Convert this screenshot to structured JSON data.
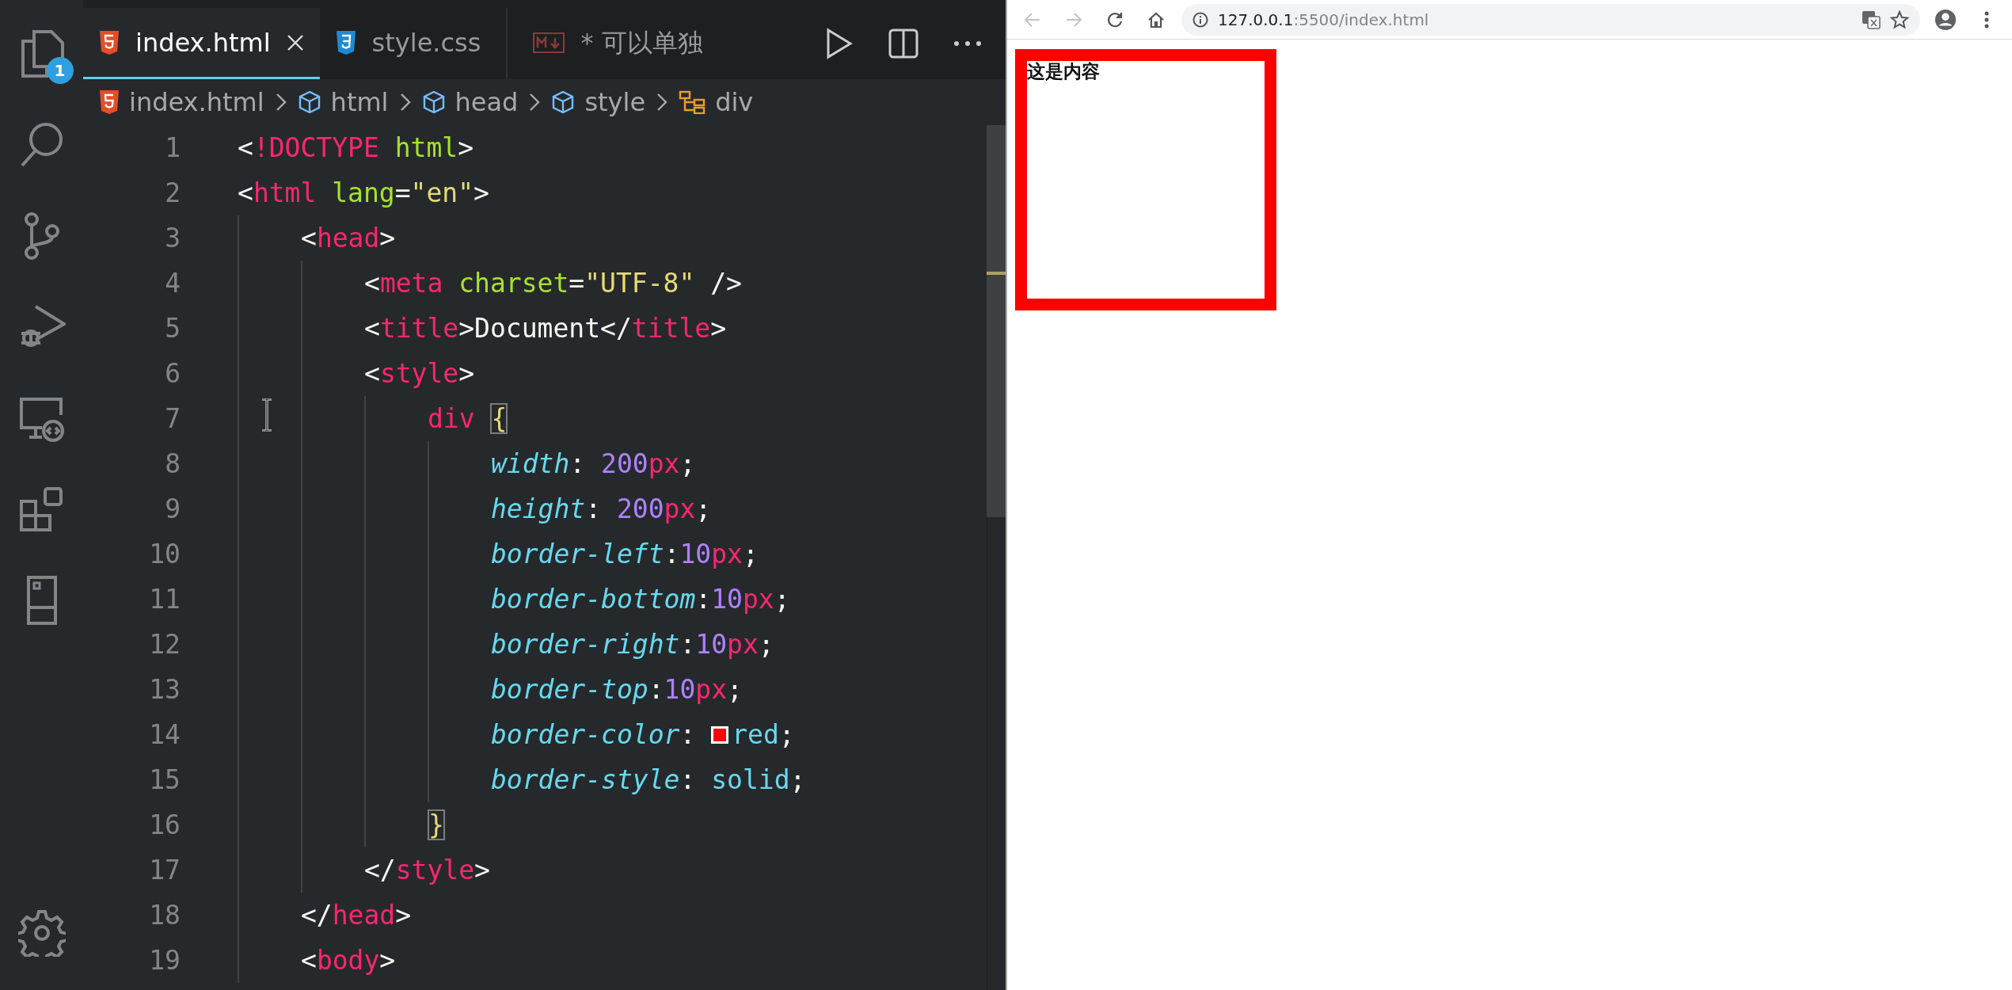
{
  "activity_bar": {
    "items": [
      {
        "kind": "files",
        "badge": "1"
      },
      {
        "kind": "search"
      },
      {
        "kind": "source-control"
      },
      {
        "kind": "run-debug"
      },
      {
        "kind": "remote"
      },
      {
        "kind": "extensions"
      },
      {
        "kind": "panel"
      }
    ],
    "bottom_items": [
      {
        "kind": "settings"
      }
    ]
  },
  "tabs": [
    {
      "label": "index.html",
      "kind": "html",
      "selected": true
    },
    {
      "label": "style.css",
      "kind": "css",
      "selected": false
    },
    {
      "label": "* 可以单独",
      "kind": "markdown",
      "selected": false
    }
  ],
  "breadcrumbs": [
    {
      "label": "index.html",
      "kind": "html"
    },
    {
      "label": "html",
      "kind": "element"
    },
    {
      "label": "head",
      "kind": "element"
    },
    {
      "label": "style",
      "kind": "element"
    },
    {
      "label": "div",
      "kind": "selector"
    }
  ],
  "code": {
    "lines": [
      {
        "number": "1",
        "tokens": [
          {
            "text": "<",
            "kind": "punct"
          },
          {
            "text": "!DOCTYPE",
            "kind": "tag"
          },
          {
            "text": " html",
            "kind": "attr"
          },
          {
            "text": ">",
            "kind": "punct"
          }
        ]
      },
      {
        "number": "2",
        "tokens": [
          {
            "text": "<",
            "kind": "punct"
          },
          {
            "text": "html",
            "kind": "tag"
          },
          {
            "text": " lang",
            "kind": "attr"
          },
          {
            "text": "=",
            "kind": "punct"
          },
          {
            "text": "\"en\"",
            "kind": "string"
          },
          {
            "text": ">",
            "kind": "punct"
          }
        ],
        "children": [
          {
            "number": "3",
            "tokens": [
              {
                "text": "<",
                "kind": "punct"
              },
              {
                "text": "head",
                "kind": "tag"
              },
              {
                "text": ">",
                "kind": "punct"
              }
            ],
            "children": [
              {
                "number": "4",
                "tokens": [
                  {
                    "text": "<",
                    "kind": "punct"
                  },
                  {
                    "text": "meta",
                    "kind": "tag"
                  },
                  {
                    "text": " charset",
                    "kind": "attr"
                  },
                  {
                    "text": "=",
                    "kind": "punct"
                  },
                  {
                    "text": "\"UTF-8\"",
                    "kind": "string"
                  },
                  {
                    "text": " />",
                    "kind": "punct"
                  }
                ]
              },
              {
                "number": "5",
                "tokens": [
                  {
                    "text": "<",
                    "kind": "punct"
                  },
                  {
                    "text": "title",
                    "kind": "tag"
                  },
                  {
                    "text": ">",
                    "kind": "punct"
                  },
                  {
                    "text": "Document",
                    "kind": "text"
                  },
                  {
                    "text": "</",
                    "kind": "punct"
                  },
                  {
                    "text": "title",
                    "kind": "tag"
                  },
                  {
                    "text": ">",
                    "kind": "punct"
                  }
                ]
              },
              {
                "number": "6",
                "tokens": [
                  {
                    "text": "<",
                    "kind": "punct"
                  },
                  {
                    "text": "style",
                    "kind": "tag"
                  },
                  {
                    "text": ">",
                    "kind": "punct"
                  }
                ],
                "children": [
                  {
                    "number": "7",
                    "tokens": [
                      {
                        "text": "div ",
                        "kind": "tag"
                      },
                      {
                        "text": "{",
                        "kind": "bracket-match"
                      }
                    ],
                    "children": [
                      {
                        "number": "8",
                        "tokens": [
                          {
                            "text": "width",
                            "kind": "prop"
                          },
                          {
                            "text": ": ",
                            "kind": "punct"
                          },
                          {
                            "text": "200",
                            "kind": "number"
                          },
                          {
                            "text": "px",
                            "kind": "unit"
                          },
                          {
                            "text": ";",
                            "kind": "punct"
                          }
                        ]
                      },
                      {
                        "number": "9",
                        "tokens": [
                          {
                            "text": "height",
                            "kind": "prop"
                          },
                          {
                            "text": ": ",
                            "kind": "punct"
                          },
                          {
                            "text": "200",
                            "kind": "number"
                          },
                          {
                            "text": "px",
                            "kind": "unit"
                          },
                          {
                            "text": ";",
                            "kind": "punct"
                          }
                        ]
                      },
                      {
                        "number": "10",
                        "tokens": [
                          {
                            "text": "border-left",
                            "kind": "prop"
                          },
                          {
                            "text": ":",
                            "kind": "punct"
                          },
                          {
                            "text": "10",
                            "kind": "number"
                          },
                          {
                            "text": "px",
                            "kind": "unit"
                          },
                          {
                            "text": ";",
                            "kind": "punct"
                          }
                        ]
                      },
                      {
                        "number": "11",
                        "tokens": [
                          {
                            "text": "border-bottom",
                            "kind": "prop"
                          },
                          {
                            "text": ":",
                            "kind": "punct"
                          },
                          {
                            "text": "10",
                            "kind": "number"
                          },
                          {
                            "text": "px",
                            "kind": "unit"
                          },
                          {
                            "text": ";",
                            "kind": "punct"
                          }
                        ]
                      },
                      {
                        "number": "12",
                        "tokens": [
                          {
                            "text": "border-right",
                            "kind": "prop"
                          },
                          {
                            "text": ":",
                            "kind": "punct"
                          },
                          {
                            "text": "10",
                            "kind": "number"
                          },
                          {
                            "text": "px",
                            "kind": "unit"
                          },
                          {
                            "text": ";",
                            "kind": "punct"
                          }
                        ]
                      },
                      {
                        "number": "13",
                        "tokens": [
                          {
                            "text": "border-top",
                            "kind": "prop"
                          },
                          {
                            "text": ":",
                            "kind": "punct"
                          },
                          {
                            "text": "10",
                            "kind": "number"
                          },
                          {
                            "text": "px",
                            "kind": "unit"
                          },
                          {
                            "text": ";",
                            "kind": "punct"
                          }
                        ]
                      },
                      {
                        "number": "14",
                        "tokens": [
                          {
                            "text": "border-color",
                            "kind": "prop"
                          },
                          {
                            "text": ": ",
                            "kind": "punct"
                          },
                          {
                            "kind": "swatch",
                            "color": "#ff0000"
                          },
                          {
                            "text": "red",
                            "kind": "value"
                          },
                          {
                            "text": ";",
                            "kind": "punct"
                          }
                        ]
                      },
                      {
                        "number": "15",
                        "tokens": [
                          {
                            "text": "border-style",
                            "kind": "prop"
                          },
                          {
                            "text": ": ",
                            "kind": "punct"
                          },
                          {
                            "text": "solid",
                            "kind": "value"
                          },
                          {
                            "text": ";",
                            "kind": "punct"
                          }
                        ]
                      }
                    ]
                  },
                  {
                    "number": "16",
                    "tokens": [
                      {
                        "text": "}",
                        "kind": "bracket-match"
                      }
                    ]
                  }
                ]
              },
              {
                "number": "17",
                "tokens": [
                  {
                    "text": "</",
                    "kind": "punct"
                  },
                  {
                    "text": "style",
                    "kind": "tag"
                  },
                  {
                    "text": ">",
                    "kind": "punct"
                  }
                ]
              }
            ]
          },
          {
            "number": "18",
            "tokens": [
              {
                "text": "</",
                "kind": "punct"
              },
              {
                "text": "head",
                "kind": "tag"
              },
              {
                "text": ">",
                "kind": "punct"
              }
            ]
          },
          {
            "number": "19",
            "tokens": [
              {
                "text": "<",
                "kind": "punct"
              },
              {
                "text": "body",
                "kind": "tag"
              },
              {
                "text": ">",
                "kind": "punct"
              }
            ]
          }
        ]
      }
    ]
  },
  "browser": {
    "url_host": "127.0.0.1",
    "url_path": ":5500/index.html",
    "page_text": "这是内容"
  }
}
